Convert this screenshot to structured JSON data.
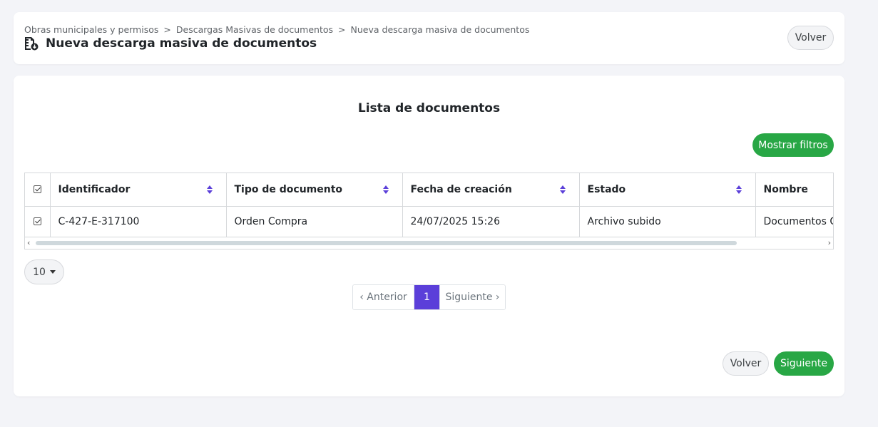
{
  "breadcrumb": {
    "items": [
      "Obras municipales y permisos",
      "Descargas Masivas de documentos",
      "Nueva descarga masiva de documentos"
    ],
    "separator": ">"
  },
  "header": {
    "title": "Nueva descarga masiva de documentos",
    "back_label": "Volver",
    "icon": "document-download-icon"
  },
  "main": {
    "section_title": "Lista de documentos",
    "filters_label": "Mostrar filtros"
  },
  "table": {
    "columns": [
      "Identificador",
      "Tipo de documento",
      "Fecha de creación",
      "Estado",
      "Nombre"
    ],
    "rows": [
      {
        "checked": true,
        "identificador": "C-427-E-317100",
        "tipo": "Orden Compra",
        "fecha": "24/07/2025 15:26",
        "estado": "Archivo subido",
        "nombre": "Documentos Generales"
      }
    ]
  },
  "pagination": {
    "page_size": "10",
    "prev_label": "‹ Anterior",
    "current_page": "1",
    "next_label": "Siguiente ›"
  },
  "footer": {
    "back_label": "Volver",
    "next_label": "Siguiente"
  },
  "colors": {
    "accent_green": "#28a745",
    "accent_purple": "#5b3fd9",
    "sort_icon": "#5b3fd9"
  }
}
